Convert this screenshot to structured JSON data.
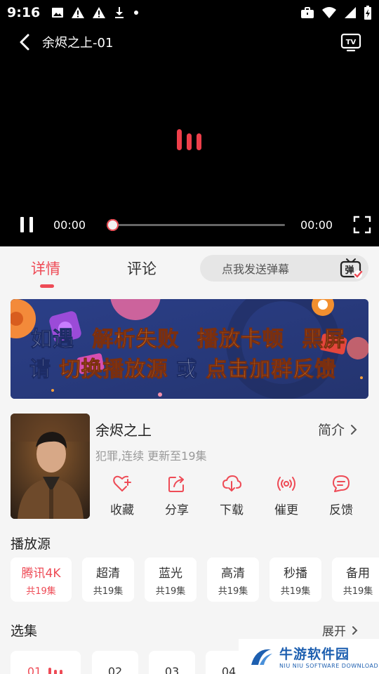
{
  "status_bar": {
    "time": "9:16"
  },
  "player": {
    "title": "余烬之上-01",
    "current_time": "00:00",
    "total_time": "00:00",
    "progress": 0
  },
  "tabs": {
    "details": "详情",
    "comments": "评论"
  },
  "danmu": {
    "placeholder": "点我发送弹幕",
    "icon_label": "弹"
  },
  "banner": {
    "line1": [
      "如遇",
      "解析失败",
      "播放卡顿",
      "黑屏"
    ],
    "line2": [
      "请",
      "切换播放源",
      "或",
      "点击加群反馈"
    ]
  },
  "show": {
    "title": "余烬之上",
    "intro": "简介",
    "meta": "犯罪,连续 更新至19集"
  },
  "actions": [
    {
      "label": "收藏",
      "icon": "heart-plus-icon"
    },
    {
      "label": "分享",
      "icon": "share-icon"
    },
    {
      "label": "下载",
      "icon": "cloud-download-icon"
    },
    {
      "label": "催更",
      "icon": "broadcast-icon"
    },
    {
      "label": "反馈",
      "icon": "feedback-chat-icon"
    }
  ],
  "sources": {
    "title": "播放源",
    "items": [
      {
        "name": "腾讯4K",
        "count": "共19集",
        "selected": true
      },
      {
        "name": "超清",
        "count": "共19集"
      },
      {
        "name": "蓝光",
        "count": "共19集"
      },
      {
        "name": "高清",
        "count": "共19集"
      },
      {
        "name": "秒播",
        "count": "共19集"
      },
      {
        "name": "备用",
        "count": "共19集"
      }
    ]
  },
  "episodes": {
    "title": "选集",
    "expand": "展开",
    "items": [
      {
        "label": "01",
        "selected": true
      },
      {
        "label": "02"
      },
      {
        "label": "03"
      },
      {
        "label": "04"
      }
    ]
  },
  "watermark": {
    "main": "牛游软件园",
    "sub": "NIU NIU SOFTWARE DOWNLOAD"
  },
  "colors": {
    "accent": "#ee4b56",
    "banner_bg": "#2a3d82",
    "banner_highlight": "#f9a03a"
  }
}
